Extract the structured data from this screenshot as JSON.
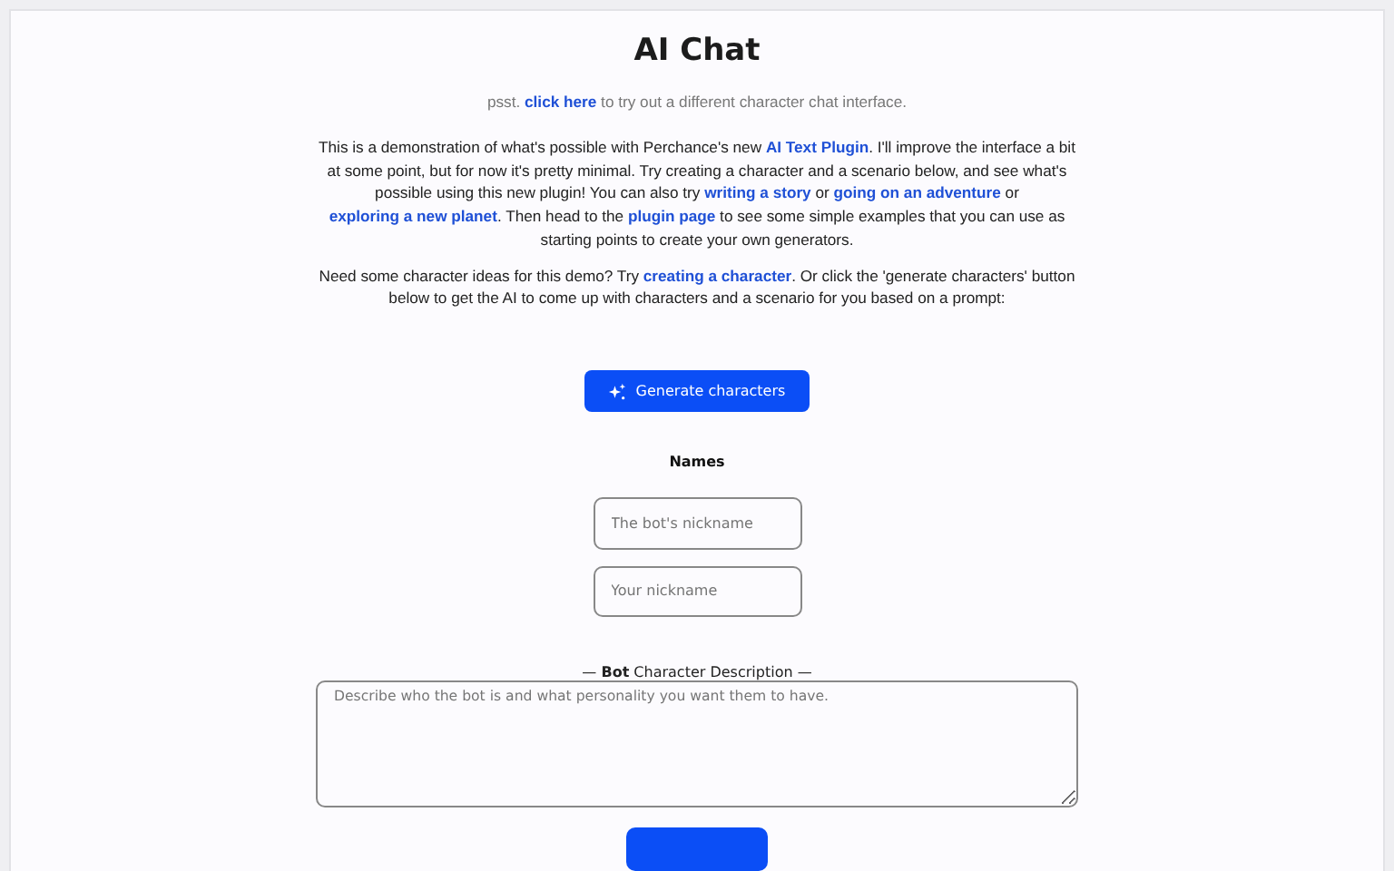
{
  "title": "AI Chat",
  "notice": [
    {
      "text": "psst. ",
      "link": false
    },
    {
      "text": "click here",
      "link": true
    },
    {
      "text": " to try out a different character chat interface.",
      "link": false
    }
  ],
  "paragraphs": [
    [
      {
        "text": "This is a demonstration of what's possible with Perchance's new ",
        "link": false
      },
      {
        "text": "AI Text Plugin",
        "link": true
      },
      {
        "text": ". I'll improve the interface a bit at some point, but for now it's pretty minimal. Try creating a character and a scenario below, and see what's possible using this new plugin! You can also try ",
        "link": false
      },
      {
        "text": "writing a story",
        "link": true
      },
      {
        "text": " or ",
        "link": false
      },
      {
        "text": "going on an adventure",
        "link": true
      },
      {
        "text": " or ",
        "link": false
      },
      {
        "text": "exploring a new planet",
        "link": true
      },
      {
        "text": ". Then head to the ",
        "link": false
      },
      {
        "text": "plugin page",
        "link": true
      },
      {
        "text": " to see some simple examples that you can use as starting points to create your own generators.",
        "link": false
      }
    ],
    [
      {
        "text": "Need some character ideas for this demo? Try  ",
        "link": false
      },
      {
        "text": "creating a character",
        "link": true
      },
      {
        "text": ". Or click the 'generate characters' button below to get the AI to come up with characters and a scenario for you based on a prompt:",
        "link": false
      }
    ]
  ],
  "generate_button": "Generate characters",
  "names_heading": "Names",
  "name_fields": [
    {
      "placeholder": "The bot's nickname"
    },
    {
      "placeholder": "Your nickname"
    }
  ],
  "description": {
    "label": "— **Bot** Character Description —",
    "placeholder": "Describe who the bot is and what personality you want them to have."
  }
}
